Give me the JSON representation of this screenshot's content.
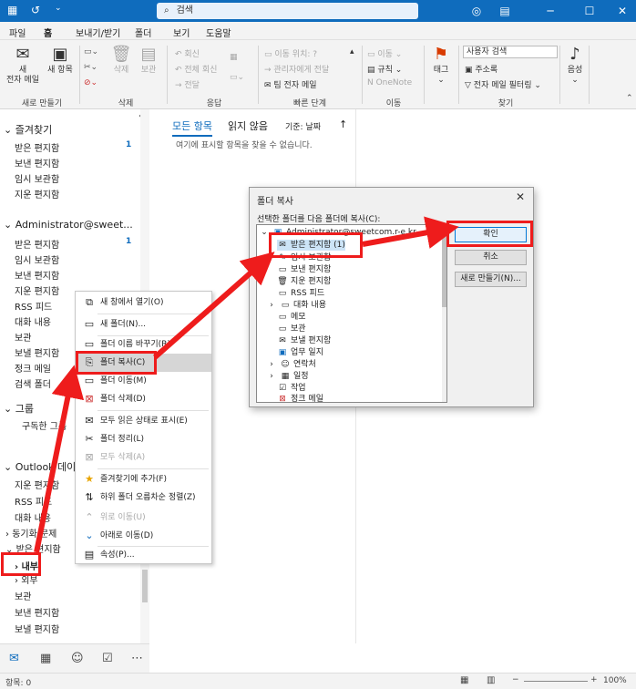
{
  "titlebar": {
    "search_text": "검색",
    "window_controls": [
      "minimize-icon",
      "maximize-icon",
      "close-icon"
    ]
  },
  "menu": {
    "tabs": [
      "파일",
      "홈",
      "보내기/받기",
      "폴더",
      "보기",
      "도움말"
    ],
    "active": "홈"
  },
  "ribbon": {
    "new_mail": "새\n전자 메일",
    "new_items": "새 항목",
    "delete": "삭제",
    "archive": "보관",
    "reply": "회신",
    "reply_all": "전체 회신",
    "forward": "전달",
    "quick_steps": [
      "이동 위치: ?",
      "관리자에게 전달",
      "팀 전자 메일"
    ],
    "move": "이동",
    "rules": "규칙",
    "onenote": "OneNote",
    "tag": "태그",
    "search_people": "사용자 검색",
    "address_book": "주소록",
    "filter_email": "전자 메일 필터링",
    "voice": "음성",
    "groups": [
      "새로 만들기",
      "삭제",
      "응답",
      "빠른 단계",
      "이동",
      "찾기"
    ]
  },
  "folderpane": {
    "favorites_header": "즐겨찾기",
    "favorites": [
      {
        "label": "받은 편지함",
        "count": "1"
      },
      {
        "label": "보낸 편지함",
        "count": ""
      },
      {
        "label": "임시 보관함",
        "count": ""
      },
      {
        "label": "지운 편지함",
        "count": ""
      }
    ],
    "account_header": "Administrator@sweet...",
    "account_folders": [
      {
        "label": "받은 편지함",
        "count": "1"
      },
      {
        "label": "임시 보관함",
        "count": ""
      },
      {
        "label": "보낸 편지함",
        "count": ""
      },
      {
        "label": "지운 편지함",
        "count": ""
      },
      {
        "label": "RSS 피드",
        "count": ""
      },
      {
        "label": "대화 내용",
        "count": ""
      },
      {
        "label": "보관",
        "count": ""
      },
      {
        "label": "보낼 편지함",
        "count": ""
      },
      {
        "label": "정크 메일",
        "count": ""
      },
      {
        "label": "검색 폴더",
        "count": ""
      }
    ],
    "groups_header": "그룹",
    "groups_item": "구독한 그룹",
    "outlook_header": "Outlook 데이터 파일",
    "outlook_folders": [
      "지운 편지함",
      "RSS 피드",
      "대화 내용",
      "동기화 문제",
      "받은 편지함",
      "내부",
      "외부",
      "보관",
      "보낸 편지함",
      "보낼 편지함"
    ]
  },
  "listpane": {
    "tab_all": "모든 항목",
    "tab_unread": "읽지 않음",
    "sort_label": "기준: 날짜",
    "empty_message": "여기에 표시할 항목을 찾을 수 없습니다."
  },
  "context_menu": {
    "items": [
      {
        "label": "새 창에서 열기(O)",
        "icon": "open-window-icon",
        "disabled": false
      },
      {
        "label": "새 폴더(N)...",
        "icon": "new-folder-icon",
        "disabled": false
      },
      {
        "label": "폴더 이름 바꾸기(R)",
        "icon": "rename-icon",
        "disabled": false
      },
      {
        "label": "폴더 복사(C)",
        "icon": "copy-folder-icon",
        "disabled": false
      },
      {
        "label": "폴더 이동(M)",
        "icon": "move-folder-icon",
        "disabled": false
      },
      {
        "label": "폴더 삭제(D)",
        "icon": "delete-folder-icon",
        "disabled": false
      },
      {
        "label": "모두 읽은 상태로 표시(E)",
        "icon": "mark-read-icon",
        "disabled": false
      },
      {
        "label": "폴더 정리(L)",
        "icon": "clean-folder-icon",
        "disabled": false
      },
      {
        "label": "모두 삭제(A)",
        "icon": "delete-all-icon",
        "disabled": true
      },
      {
        "label": "즐겨찾기에 추가(F)",
        "icon": "favorite-icon",
        "disabled": false
      },
      {
        "label": "하위 폴더 오름차순 정렬(Z)",
        "icon": "sort-icon",
        "disabled": false
      },
      {
        "label": "위로 이동(U)",
        "icon": "up-icon",
        "disabled": true
      },
      {
        "label": "아래로 이동(D)",
        "icon": "down-icon",
        "disabled": false
      },
      {
        "label": "속성(P)...",
        "icon": "properties-icon",
        "disabled": false
      }
    ]
  },
  "dialog": {
    "title": "폴더 복사",
    "prompt": "선택한 폴더를 다음 폴더에 복사(C):",
    "root": "Administrator@sweetcom.r-e.kr",
    "tree": [
      {
        "label": "받은 편지함 (1)",
        "icon": "inbox-icon",
        "indent": 1,
        "selected": true
      },
      {
        "label": "임시 보관함",
        "icon": "drafts-icon",
        "indent": 1,
        "selected": false
      },
      {
        "label": "보낸 편지함",
        "icon": "sent-icon",
        "indent": 1,
        "selected": false
      },
      {
        "label": "지운 편지함",
        "icon": "deleted-icon",
        "indent": 1,
        "selected": false
      },
      {
        "label": "RSS 피드",
        "icon": "rss-icon",
        "indent": 1,
        "selected": false
      },
      {
        "label": "대화 내용",
        "icon": "folder-icon",
        "indent": 1,
        "selected": false
      },
      {
        "label": "메모",
        "icon": "note-icon",
        "indent": 1,
        "selected": false
      },
      {
        "label": "보관",
        "icon": "archive-icon",
        "indent": 1,
        "selected": false
      },
      {
        "label": "보낼 편지함",
        "icon": "outbox-icon",
        "indent": 1,
        "selected": false
      },
      {
        "label": "업무 일지",
        "icon": "journal-icon",
        "indent": 1,
        "selected": false
      },
      {
        "label": "연락처",
        "icon": "contacts-icon",
        "indent": 1,
        "selected": false
      },
      {
        "label": "일정",
        "icon": "calendar-icon",
        "indent": 1,
        "selected": false
      },
      {
        "label": "작업",
        "icon": "task-icon",
        "indent": 1,
        "selected": false
      },
      {
        "label": "정크 메일",
        "icon": "junk-icon",
        "indent": 1,
        "selected": false
      }
    ],
    "ok": "확인",
    "cancel": "취소",
    "new": "새로 만들기(N)..."
  },
  "statusbar": {
    "items": "항목: 0",
    "zoom": "100%"
  },
  "colors": {
    "accent": "#0f6cbd",
    "annotation_red": "#ee1c1c"
  }
}
